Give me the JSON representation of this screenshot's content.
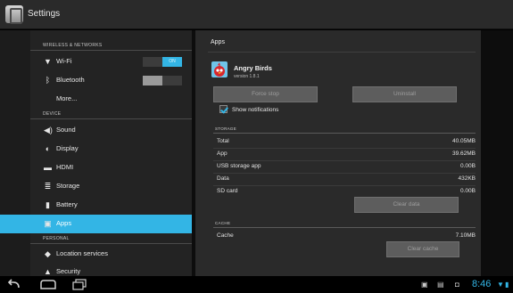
{
  "topbar": {
    "title": "Settings",
    "icon": "settings-app-icon"
  },
  "sidebar": {
    "sections": {
      "wireless": "WIRELESS & NETWORKS",
      "device": "DEVICE",
      "personal": "PERSONAL"
    },
    "items": [
      {
        "label": "Wi-Fi",
        "icon": "wifi-icon",
        "toggle": "ON"
      },
      {
        "label": "Bluetooth",
        "icon": "bluetooth-icon",
        "toggle": ""
      },
      {
        "label": "More..."
      },
      {
        "label": "Sound",
        "icon": "sound-icon"
      },
      {
        "label": "Display",
        "icon": "display-icon"
      },
      {
        "label": "HDMI",
        "icon": "hdmi-icon"
      },
      {
        "label": "Storage",
        "icon": "storage-icon"
      },
      {
        "label": "Battery",
        "icon": "battery-icon"
      },
      {
        "label": "Apps",
        "icon": "apps-icon",
        "selected": true
      },
      {
        "label": "Location services",
        "icon": "location-icon"
      },
      {
        "label": "Security",
        "icon": "lock-icon"
      }
    ]
  },
  "detail": {
    "breadcrumb": "Apps",
    "app": {
      "name": "Angry Birds",
      "version": "version 1.8.1"
    },
    "buttons": {
      "force_stop": "Force stop",
      "uninstall": "Uninstall",
      "clear_data": "Clear data",
      "clear_cache": "Clear cache"
    },
    "show_notifications": "Show notifications",
    "storage_header": "STORAGE",
    "storage": [
      {
        "label": "Total",
        "value": "40.05MB"
      },
      {
        "label": "App",
        "value": "39.62MB"
      },
      {
        "label": "USB storage app",
        "value": "0.00B"
      },
      {
        "label": "Data",
        "value": "432KB"
      },
      {
        "label": "SD card",
        "value": "0.00B"
      }
    ],
    "cache_header": "CACHE",
    "cache": {
      "label": "Cache",
      "value": "7.10MB"
    }
  },
  "navbar": {
    "time": "8:46",
    "colors": {
      "accent": "#33b5e5"
    }
  }
}
